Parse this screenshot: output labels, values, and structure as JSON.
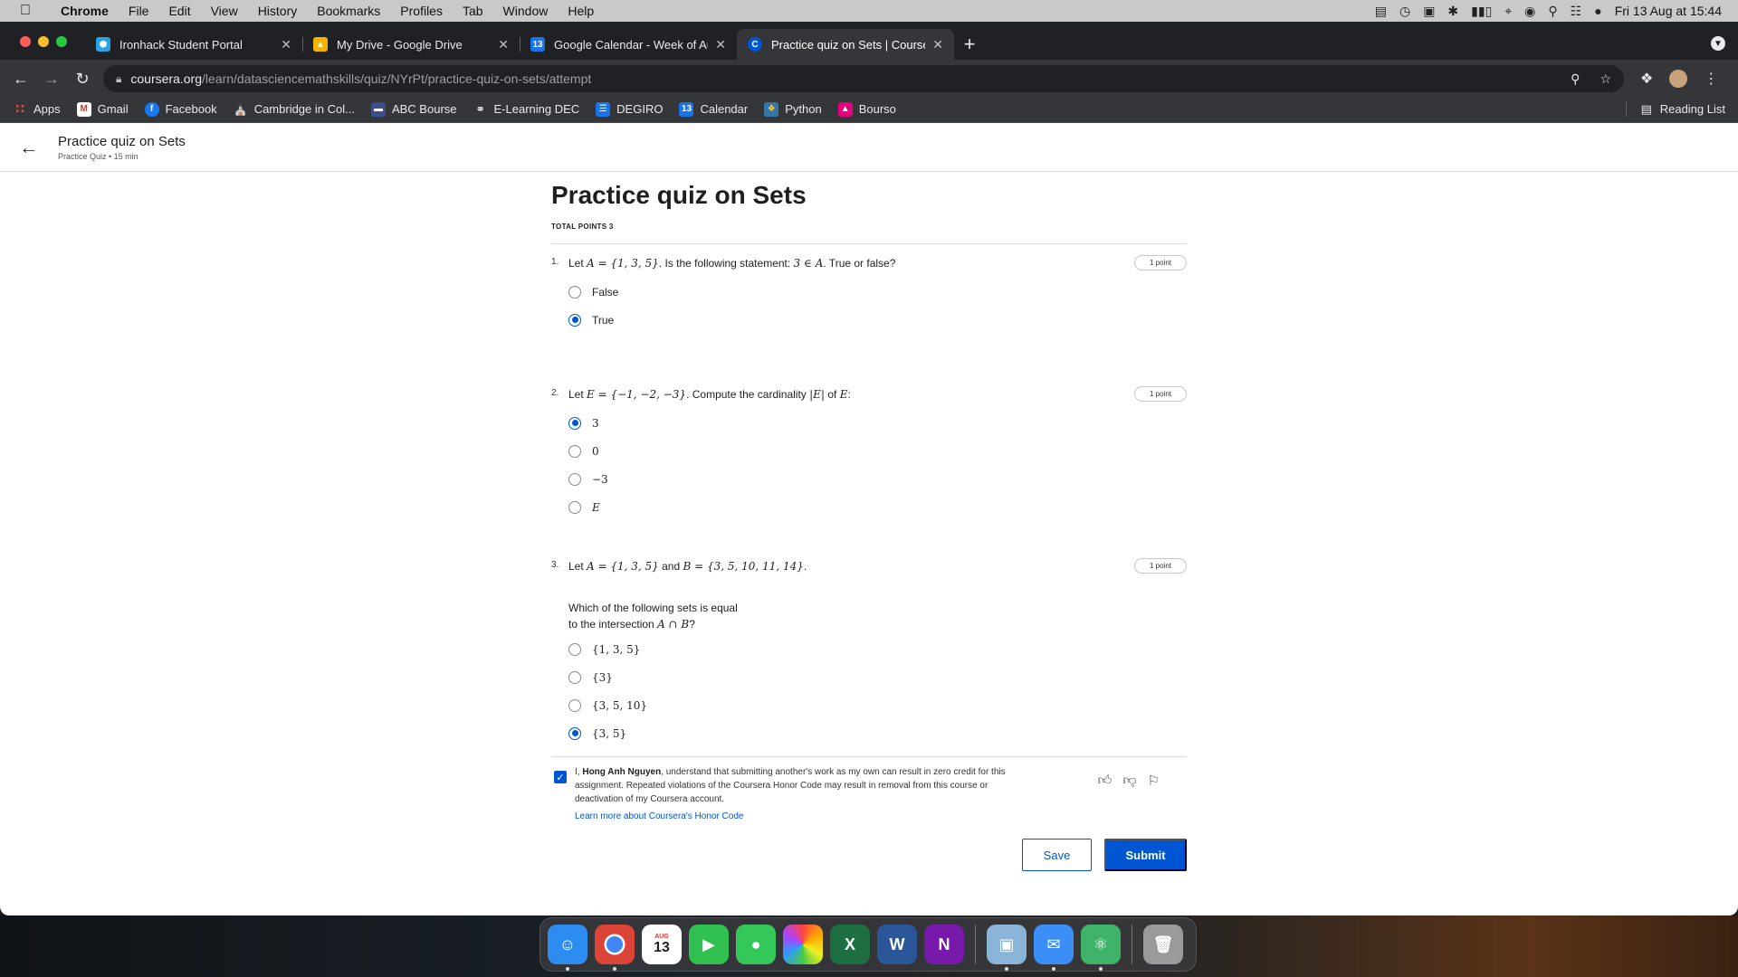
{
  "menubar": {
    "items": [
      "Chrome",
      "File",
      "Edit",
      "View",
      "History",
      "Bookmarks",
      "Profiles",
      "Tab",
      "Window",
      "Help"
    ],
    "datetime": "Fri 13 Aug at  15:44"
  },
  "tabs": [
    {
      "label": "Ironhack Student Portal",
      "favicon_color": "#29a3e6"
    },
    {
      "label": "My Drive - Google Drive",
      "favicon_color": "#f4b400"
    },
    {
      "label": "Google Calendar - Week of Au",
      "favicon_color": "#1a73e8",
      "favicon_text": "13"
    },
    {
      "label": "Practice quiz on Sets | Courser",
      "favicon_color": "#0056d2",
      "favicon_text": "C"
    }
  ],
  "address": {
    "host": "coursera.org",
    "path": "/learn/datasciencemathskills/quiz/NYrPt/practice-quiz-on-sets/attempt"
  },
  "bookmarks": [
    {
      "label": "Apps",
      "color": "#e04b3f"
    },
    {
      "label": "Gmail",
      "color": "#d93025",
      "text": "M"
    },
    {
      "label": "Facebook",
      "color": "#1877f2",
      "text": "f"
    },
    {
      "label": "Cambridge in Col...",
      "color": "#888"
    },
    {
      "label": "ABC Bourse",
      "color": "#3c4f8c"
    },
    {
      "label": "E-Learning DEC",
      "color": "#555"
    },
    {
      "label": "DEGIRO",
      "color": "#1a73e8"
    },
    {
      "label": "Calendar",
      "color": "#1a73e8",
      "text": "13"
    },
    {
      "label": "Python",
      "color": "#3776ab"
    },
    {
      "label": "Bourso",
      "color": "#e6007e"
    }
  ],
  "reading_list": "Reading List",
  "page_header": {
    "title": "Practice quiz on Sets",
    "subtitle": "Practice Quiz • 15 min"
  },
  "quiz": {
    "title": "Practice quiz on Sets",
    "total_points": "TOTAL POINTS 3",
    "questions": [
      {
        "number": "1.",
        "prefix": "Let ",
        "math1": "A = {1, 3, 5}",
        "middle": ". Is the following statement:  ",
        "math2": "3 ∈ A",
        "suffix": ".  True or false?",
        "points": "1 point",
        "options": [
          "False",
          "True"
        ],
        "selected": 1
      },
      {
        "number": "2.",
        "prefix": "Let ",
        "math1": "E = {−1, −2, −3}",
        "middle": ". Compute the cardinality ",
        "math2": "|E|",
        "mid2": " of ",
        "math3": "E",
        "suffix": ":",
        "points": "1 point",
        "options": [
          "3",
          "0",
          "−3",
          "E"
        ],
        "selected": 0
      },
      {
        "number": "3.",
        "prefix": "Let ",
        "math1": "A = {1, 3, 5}",
        "middle": " and ",
        "math2": "B = {3, 5, 10, 11, 14}",
        "suffix": ".",
        "points": "1 point",
        "prompt_line1": "Which of the following sets is equal",
        "prompt_line2_prefix": "to the intersection ",
        "prompt_math": "A ∩ B",
        "prompt_suffix": "?",
        "options": [
          "{1, 3, 5}",
          "{3}",
          "{3, 5, 10}",
          "{3, 5}"
        ],
        "selected": 3
      }
    ]
  },
  "honor": {
    "prefix": "I, ",
    "name": "Hong Anh Nguyen",
    "text": ", understand that submitting another's work as my own can result in zero credit for this assignment. Repeated violations of the Coursera Honor Code may result in removal from this course or deactivation of my Coursera account.",
    "link": "Learn more about Coursera's Honor Code",
    "checked": true
  },
  "buttons": {
    "save": "Save",
    "submit": "Submit"
  },
  "dock": [
    {
      "name": "finder",
      "color": "#2d8cf0"
    },
    {
      "name": "chrome",
      "color": "#ffffff"
    },
    {
      "name": "calendar",
      "color": "#ffffff",
      "text": "13",
      "month": "AUG"
    },
    {
      "name": "facetime",
      "color": "#30c04f"
    },
    {
      "name": "messages",
      "color": "#34c759"
    },
    {
      "name": "photos",
      "color": "#ffffff"
    },
    {
      "name": "excel",
      "color": "#1d6f42",
      "text": "X"
    },
    {
      "name": "word",
      "color": "#2b579a",
      "text": "W"
    },
    {
      "name": "onenote",
      "color": "#7719aa",
      "text": "N"
    },
    {
      "name": "preview",
      "color": "#8ab4d8"
    },
    {
      "name": "mail",
      "color": "#3a8ef6"
    },
    {
      "name": "atom",
      "color": "#40b36a"
    },
    {
      "name": "trash",
      "color": "#9a9a9a"
    }
  ]
}
